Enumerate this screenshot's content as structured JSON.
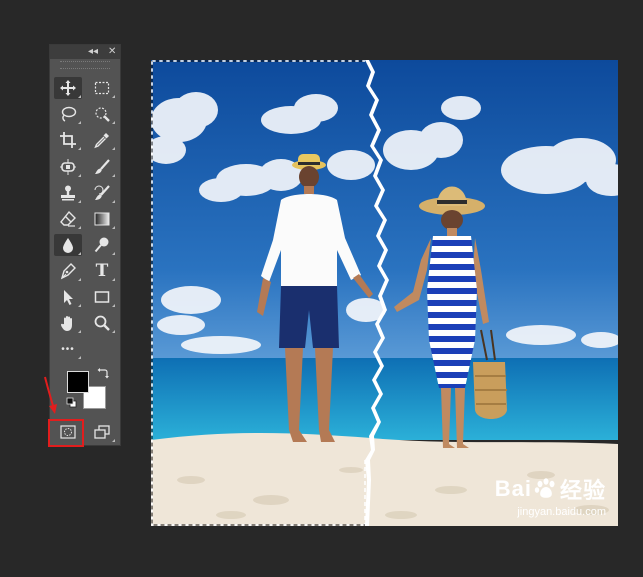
{
  "toolbar": {
    "collapse_glyph": "◂◂",
    "close_glyph": "✕",
    "tools": [
      {
        "name": "move-tool",
        "icon": "move-icon",
        "active": true
      },
      {
        "name": "rect-marquee-tool",
        "icon": "rect-marquee-icon"
      },
      {
        "name": "lasso-tool",
        "icon": "lasso-icon"
      },
      {
        "name": "quick-select-tool",
        "icon": "quick-select-icon"
      },
      {
        "name": "crop-tool",
        "icon": "crop-icon"
      },
      {
        "name": "eyedropper-tool",
        "icon": "eyedropper-icon"
      },
      {
        "name": "spot-heal-tool",
        "icon": "bandage-icon"
      },
      {
        "name": "brush-tool",
        "icon": "brush-icon"
      },
      {
        "name": "clone-stamp-tool",
        "icon": "stamp-icon"
      },
      {
        "name": "history-brush-tool",
        "icon": "history-brush-icon"
      },
      {
        "name": "eraser-tool",
        "icon": "eraser-icon"
      },
      {
        "name": "gradient-tool",
        "icon": "gradient-icon"
      },
      {
        "name": "blur-tool",
        "icon": "drop-icon",
        "active": true
      },
      {
        "name": "dodge-tool",
        "icon": "dodge-icon"
      },
      {
        "name": "pen-tool",
        "icon": "pen-icon"
      },
      {
        "name": "type-tool",
        "icon": "type-icon",
        "label": "T"
      },
      {
        "name": "path-select-tool",
        "icon": "arrow-icon"
      },
      {
        "name": "shape-tool",
        "icon": "rectangle-icon"
      },
      {
        "name": "hand-tool",
        "icon": "hand-icon"
      },
      {
        "name": "zoom-tool",
        "icon": "zoom-icon"
      },
      {
        "name": "more-tools",
        "icon": "ellipsis-icon",
        "label": "•••"
      },
      {
        "name": "quick-mask-button",
        "icon": "quick-mask-icon"
      },
      {
        "name": "screen-mode-button",
        "icon": "screen-mode-icon"
      }
    ],
    "foreground_color": "#000000",
    "background_color": "#ffffff"
  },
  "annotation": {
    "highlight_color": "#e21d1d",
    "highlighted_tool": "quick-mask-button"
  },
  "canvas": {
    "sky_color": "#1d5fae",
    "sea_color": "#1a86c6",
    "sand_color": "#efe6d8"
  },
  "watermark": {
    "logo_text_left": "Bai",
    "logo_text_right": "经验",
    "site": "jingyan.baidu.com"
  }
}
